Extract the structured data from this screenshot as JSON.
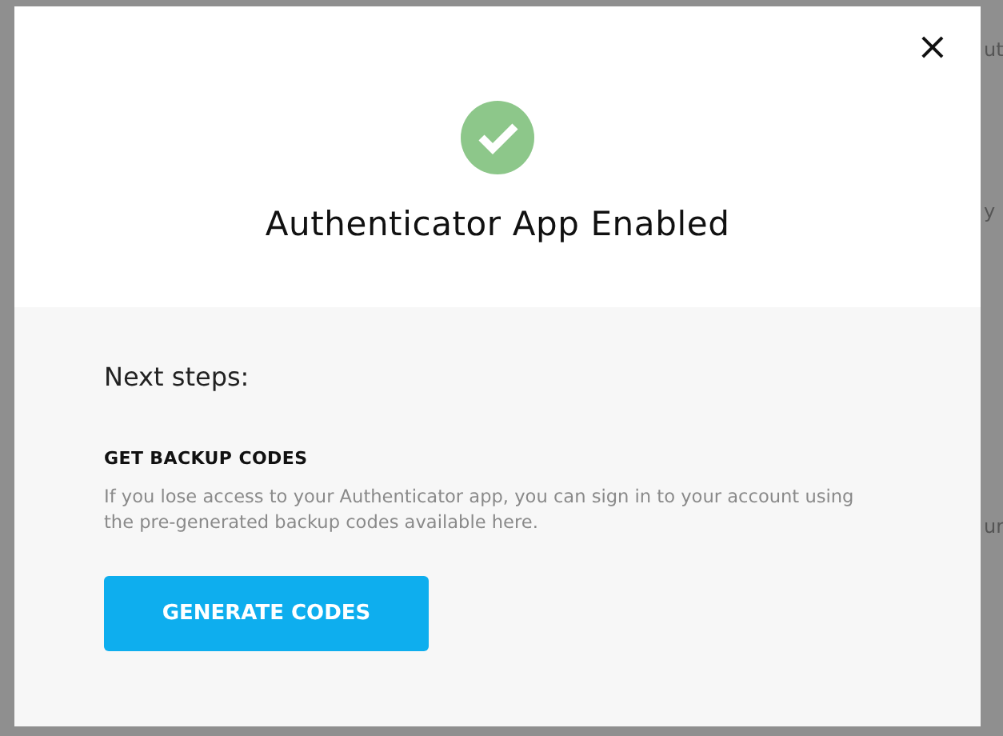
{
  "dialog": {
    "close_icon": "×",
    "title": "Authenticator App Enabled",
    "subtitle": "Next steps:",
    "section_heading": "GET BACKUP CODES",
    "description": "If you lose access to your Authenticator app, you can sign in to your account using the pre-generated backup codes available here.",
    "button": "GENERATE CODES"
  },
  "background_fragments": [
    "ut",
    "y",
    "ur"
  ]
}
